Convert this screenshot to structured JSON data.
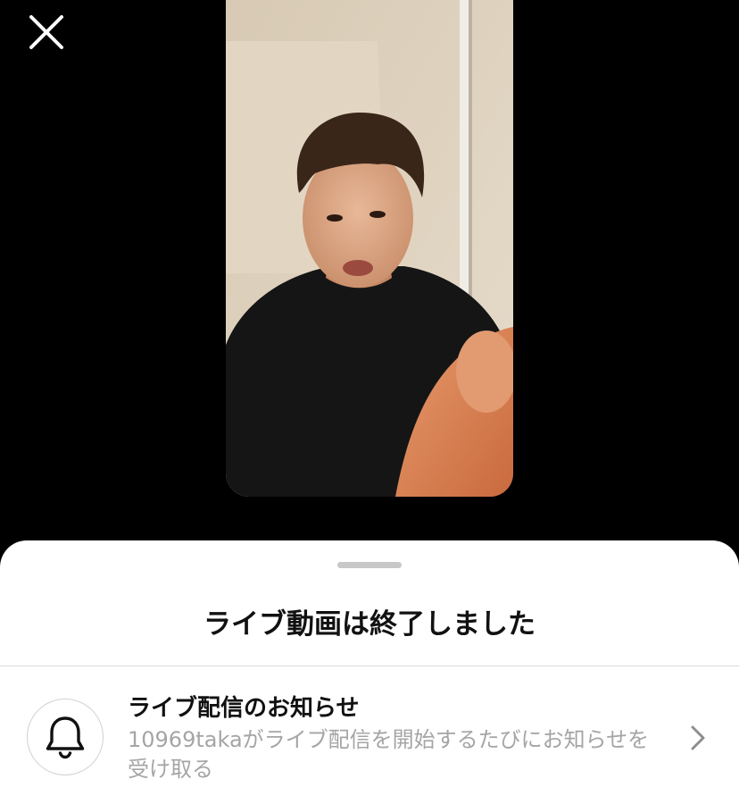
{
  "top": {
    "close_icon": "close-icon"
  },
  "video": {
    "thumbnail_icon": "live-video-thumbnail"
  },
  "sheet": {
    "title": "ライブ動画は終了しました",
    "notification": {
      "icon": "bell-icon",
      "title": "ライブ配信のお知らせ",
      "description": "10969takaがライブ配信を開始するたびにお知らせを受け取る",
      "chevron_icon": "chevron-right-icon"
    }
  },
  "colors": {
    "background": "#000000",
    "sheet": "#ffffff",
    "title_text": "#111111",
    "secondary_text": "#a5a5a5",
    "divider": "#dbdbdb"
  }
}
